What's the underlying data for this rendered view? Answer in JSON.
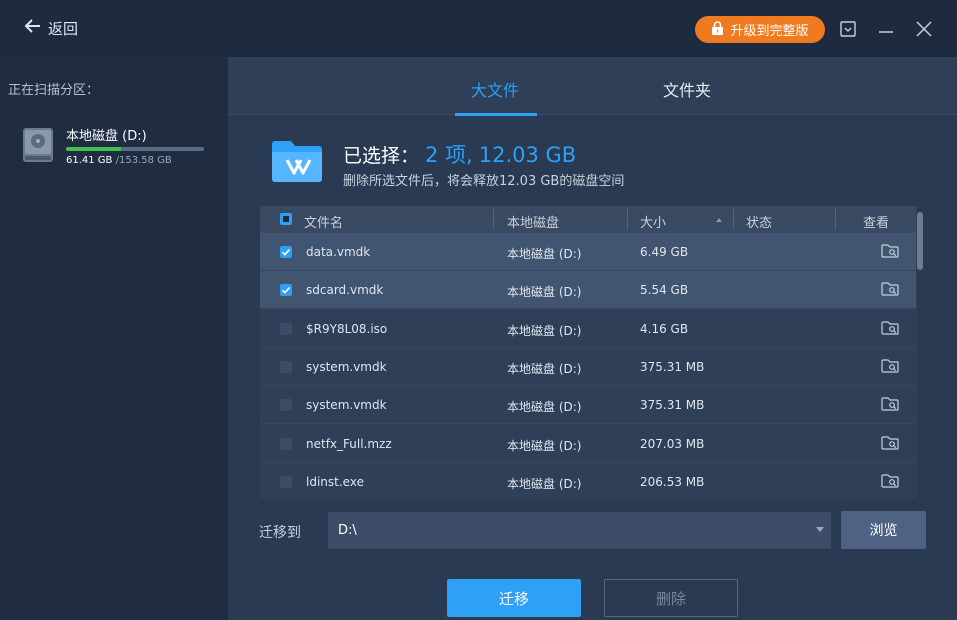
{
  "titlebar": {
    "back_label": "返回",
    "upgrade_label": "升级到完整版",
    "accent_color": "#f07a1f"
  },
  "sidebar": {
    "heading": "正在扫描分区：",
    "disk": {
      "name": "本地磁盘 (D:)",
      "used": "61.41 GB",
      "total": "/153.58 GB",
      "used_fraction": 0.4,
      "bar_color": "#3fc24c"
    }
  },
  "tabs": [
    {
      "label": "大文件",
      "active": true
    },
    {
      "label": "文件夹",
      "active": false
    }
  ],
  "summary": {
    "prefix": "已选择：",
    "count": "2 项,",
    "size": "12.03 GB",
    "subtitle": "删除所选文件后，将会释放12.03 GB的磁盘空间",
    "accent_color": "#2ea0f5"
  },
  "table": {
    "columns": [
      "文件名",
      "本地磁盘",
      "大小",
      "状态",
      "查看"
    ],
    "rows": [
      {
        "name": "data.vmdk",
        "disk": "本地磁盘 (D:)",
        "size": "6.49 GB",
        "status": "",
        "checked": true
      },
      {
        "name": "sdcard.vmdk",
        "disk": "本地磁盘 (D:)",
        "size": "5.54 GB",
        "status": "",
        "checked": true
      },
      {
        "name": "$R9Y8L08.iso",
        "disk": "本地磁盘 (D:)",
        "size": "4.16 GB",
        "status": "",
        "checked": false
      },
      {
        "name": "system.vmdk",
        "disk": "本地磁盘 (D:)",
        "size": "375.31 MB",
        "status": "",
        "checked": false
      },
      {
        "name": "system.vmdk",
        "disk": "本地磁盘 (D:)",
        "size": "375.31 MB",
        "status": "",
        "checked": false
      },
      {
        "name": "netfx_Full.mzz",
        "disk": "本地磁盘 (D:)",
        "size": "207.03 MB",
        "status": "",
        "checked": false
      },
      {
        "name": "ldinst.exe",
        "disk": "本地磁盘 (D:)",
        "size": "206.53 MB",
        "status": "",
        "checked": false
      }
    ]
  },
  "move": {
    "label": "迁移到",
    "path": "D:\\",
    "browse_label": "浏览"
  },
  "actions": {
    "migrate_label": "迁移",
    "delete_label": "删除"
  }
}
